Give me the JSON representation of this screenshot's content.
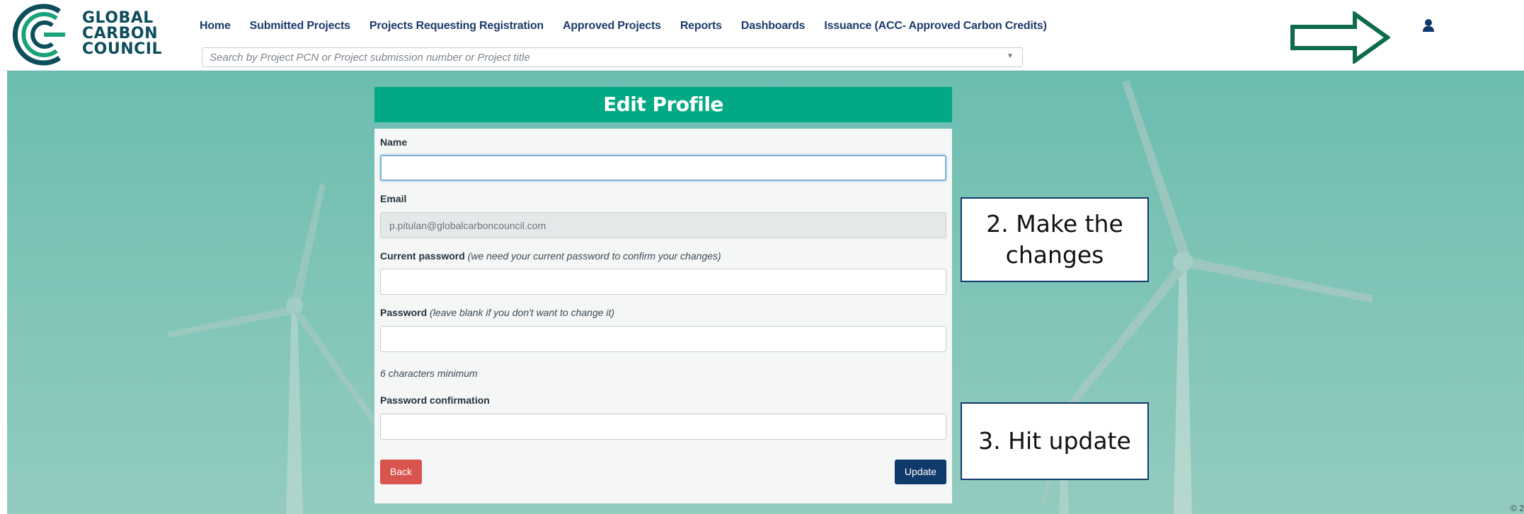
{
  "header": {
    "logo": {
      "line1": "GLOBAL",
      "line2": "CARBON",
      "line3": "COUNCIL",
      "icon": "gcc-arc-logo-icon"
    },
    "nav": [
      {
        "label": "Home"
      },
      {
        "label": "Submitted Projects"
      },
      {
        "label": "Projects Requesting Registration"
      },
      {
        "label": "Approved Projects"
      },
      {
        "label": "Reports"
      },
      {
        "label": "Dashboards"
      },
      {
        "label": "Issuance (ACC- Approved Carbon Credits)"
      }
    ],
    "search": {
      "placeholder": "Search by Project PCN or Project submission number or Project title",
      "value": ""
    },
    "user_icon": "user-icon",
    "arrow_icon": "right-arrow-outline-icon"
  },
  "form": {
    "title": "Edit Profile",
    "name_label": "Name",
    "name_value": "",
    "email_label": "Email",
    "email_value": "p.pitulan@globalcarboncouncil.com",
    "current_password_label": "Current password",
    "current_password_hint": "(we need your current password to confirm your changes)",
    "password_label": "Password",
    "password_hint": "(leave blank if you don't want to change it)",
    "password_min_hint": "6 characters minimum",
    "password_confirmation_label": "Password confirmation",
    "back_label": "Back",
    "update_label": "Update"
  },
  "annotations": {
    "step2": "2. Make the changes",
    "step3": "3. Hit update"
  },
  "footer": {
    "copyright": "© 2"
  },
  "colors": {
    "accent": "#03a884",
    "nav_text": "#1c3c6b",
    "update_button": "#103a6b",
    "back_button": "#d9534f",
    "arrow": "#0e6b4f",
    "background": "#7ec4b7"
  }
}
